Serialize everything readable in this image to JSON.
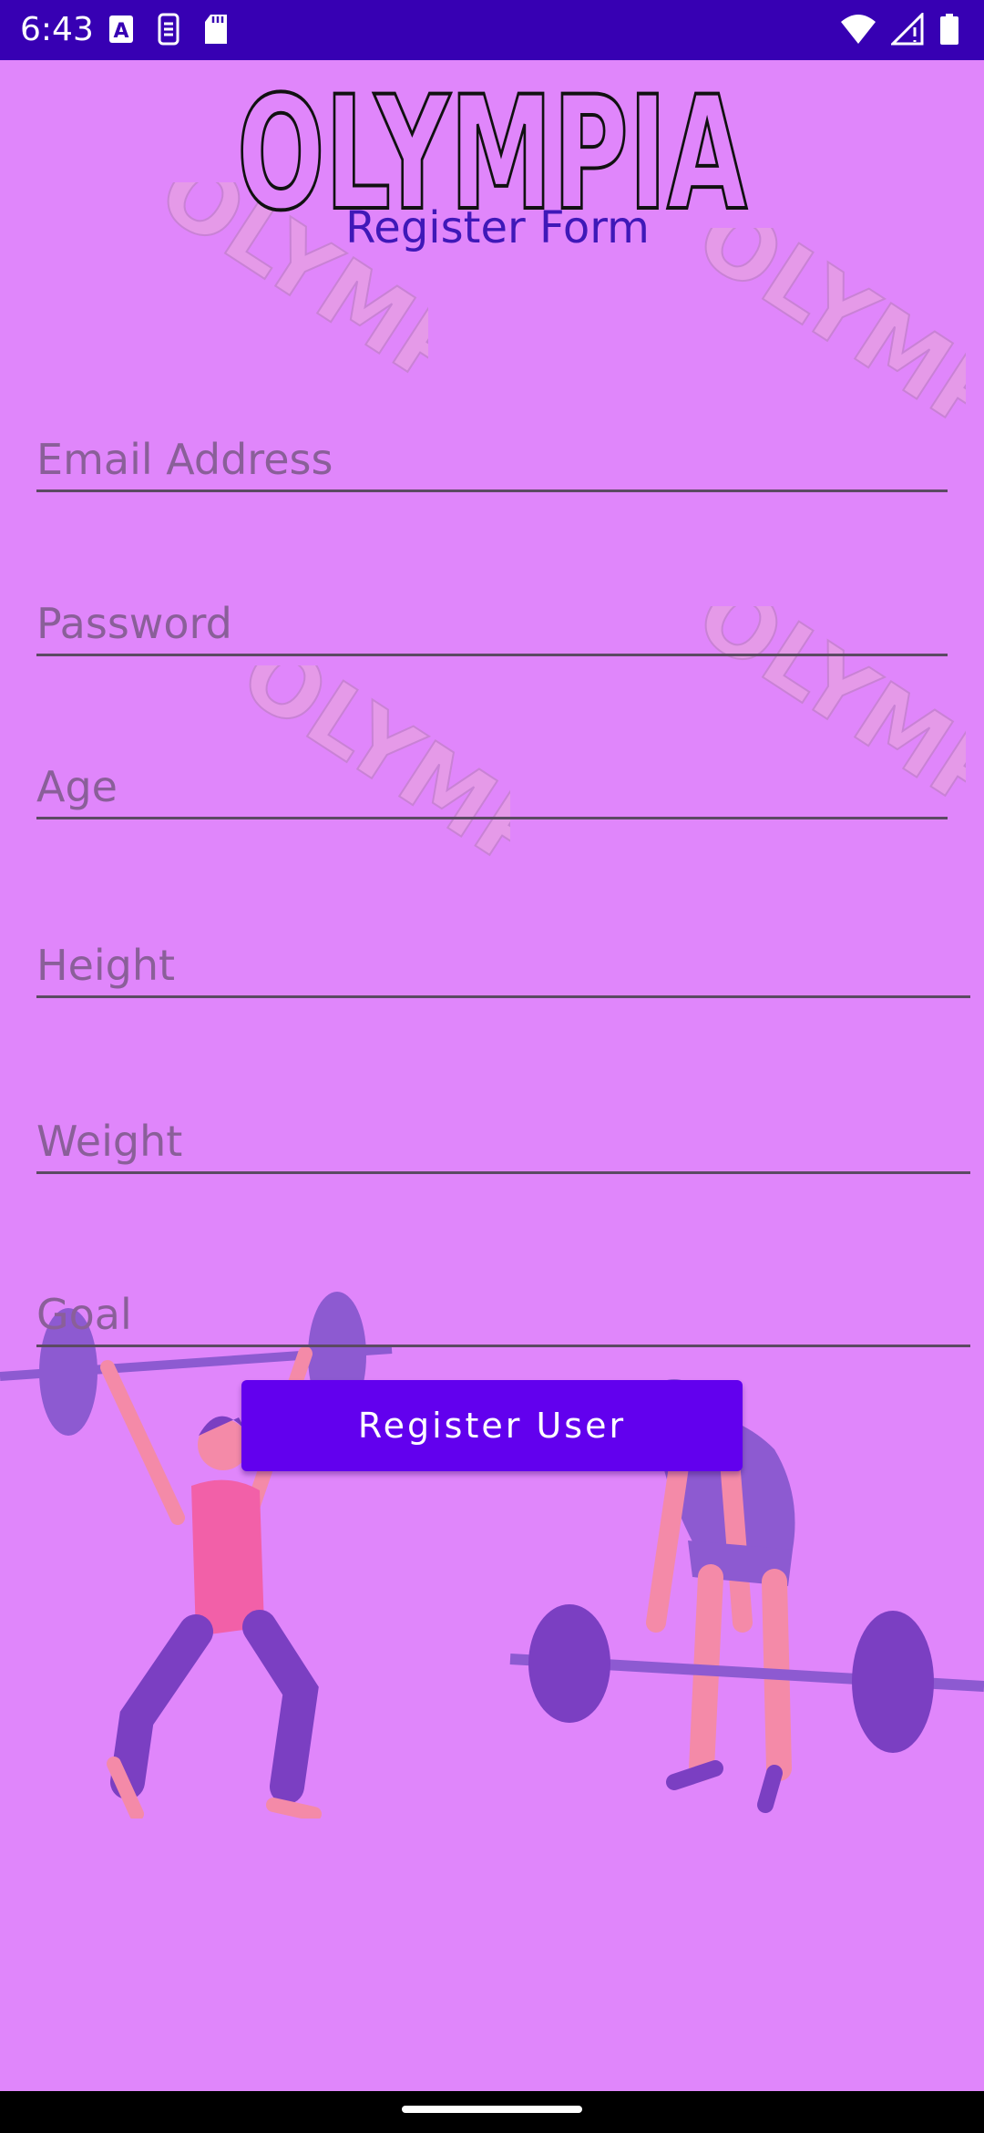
{
  "status_bar": {
    "time": "6:43",
    "background": "#3700b3",
    "left_icons": [
      "a-icon",
      "sim-toolkit-icon",
      "sd-card-icon"
    ],
    "right_icons": [
      "wifi-icon",
      "signal-icon",
      "battery-icon"
    ]
  },
  "app": {
    "logo_text": "OLYMPIA",
    "watermark_text": "OLYMPIA",
    "form_title": "Register Form",
    "background": "#e086fb",
    "accent": "#6200ee"
  },
  "form": {
    "email": {
      "placeholder": "Email Address",
      "value": ""
    },
    "password": {
      "placeholder": "Password",
      "value": ""
    },
    "age": {
      "placeholder": "Age",
      "value": ""
    },
    "height": {
      "placeholder": "Height",
      "value": ""
    },
    "weight": {
      "placeholder": "Weight",
      "value": ""
    },
    "goal": {
      "placeholder": "Goal",
      "value": ""
    },
    "submit_label": "Register User"
  }
}
